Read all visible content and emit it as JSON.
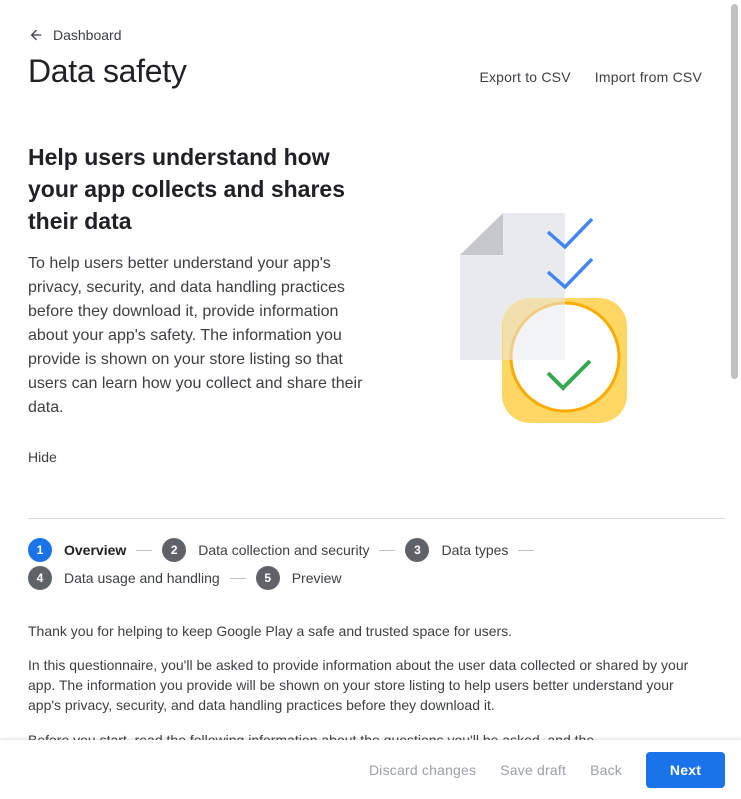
{
  "nav": {
    "back_label": "Dashboard"
  },
  "page": {
    "title": "Data safety"
  },
  "header_actions": {
    "export": "Export to CSV",
    "import": "Import from CSV"
  },
  "intro": {
    "heading": "Help users understand how your app collects and shares their data",
    "body": "To help users better understand your app's privacy, security, and data handling practices before they download it, provide information about your app's safety. The information you provide is shown on your store listing so that users can learn how you collect and share their data.",
    "hide_label": "Hide"
  },
  "stepper": {
    "steps": [
      {
        "number": "1",
        "label": "Overview",
        "active": true
      },
      {
        "number": "2",
        "label": "Data collection and security"
      },
      {
        "number": "3",
        "label": "Data types"
      },
      {
        "number": "4",
        "label": "Data usage and handling"
      },
      {
        "number": "5",
        "label": "Preview"
      }
    ]
  },
  "content": {
    "p1": "Thank you for helping to keep Google Play a safe and trusted space for users.",
    "p2": "In this questionnaire, you'll be asked to provide information about the user data collected or shared by your app. The information you provide will be shown on your store listing to help users better understand your app's privacy, security, and data handling practices before they download it.",
    "p3": "Before you start, read the following information about the questions you'll be asked, and the"
  },
  "footer": {
    "discard": "Discard changes",
    "save": "Save draft",
    "back": "Back",
    "next": "Next"
  },
  "colors": {
    "accent": "#1a73e8",
    "check_blue": "#4285f4",
    "check_green": "#34a853",
    "badge_yellow": "#fdd663"
  }
}
